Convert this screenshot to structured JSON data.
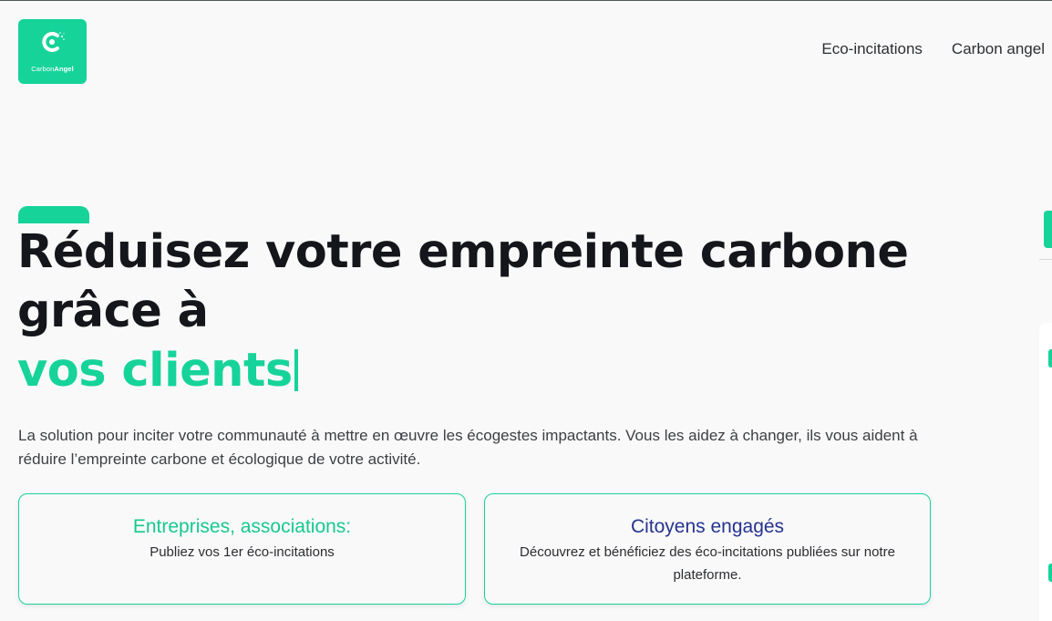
{
  "brand": {
    "name_part1": "Carbon",
    "name_part2": "Angel",
    "accent_color": "#16d39a"
  },
  "nav": {
    "items": [
      {
        "label": "Eco-incitations"
      },
      {
        "label": "Carbon angel"
      }
    ]
  },
  "hero": {
    "headline_line1": "Réduisez votre empreinte carbone",
    "headline_line2": "grâce à",
    "headline_highlight": "vos clients",
    "intro": "La solution pour inciter votre communauté à mettre en œuvre les écogestes impactants. Vous les aidez à changer, ils vous aident à réduire l’empreinte carbone et écologique de votre activité."
  },
  "cards": [
    {
      "title": "Entreprises, associations:",
      "description": "Publiez vos 1er éco-incitations",
      "title_color": "#16c98f"
    },
    {
      "title": "Citoyens engagés",
      "description": "Découvrez et bénéficiez des éco-incitations publiées sur notre plateforme.",
      "title_color": "#25338f"
    }
  ]
}
